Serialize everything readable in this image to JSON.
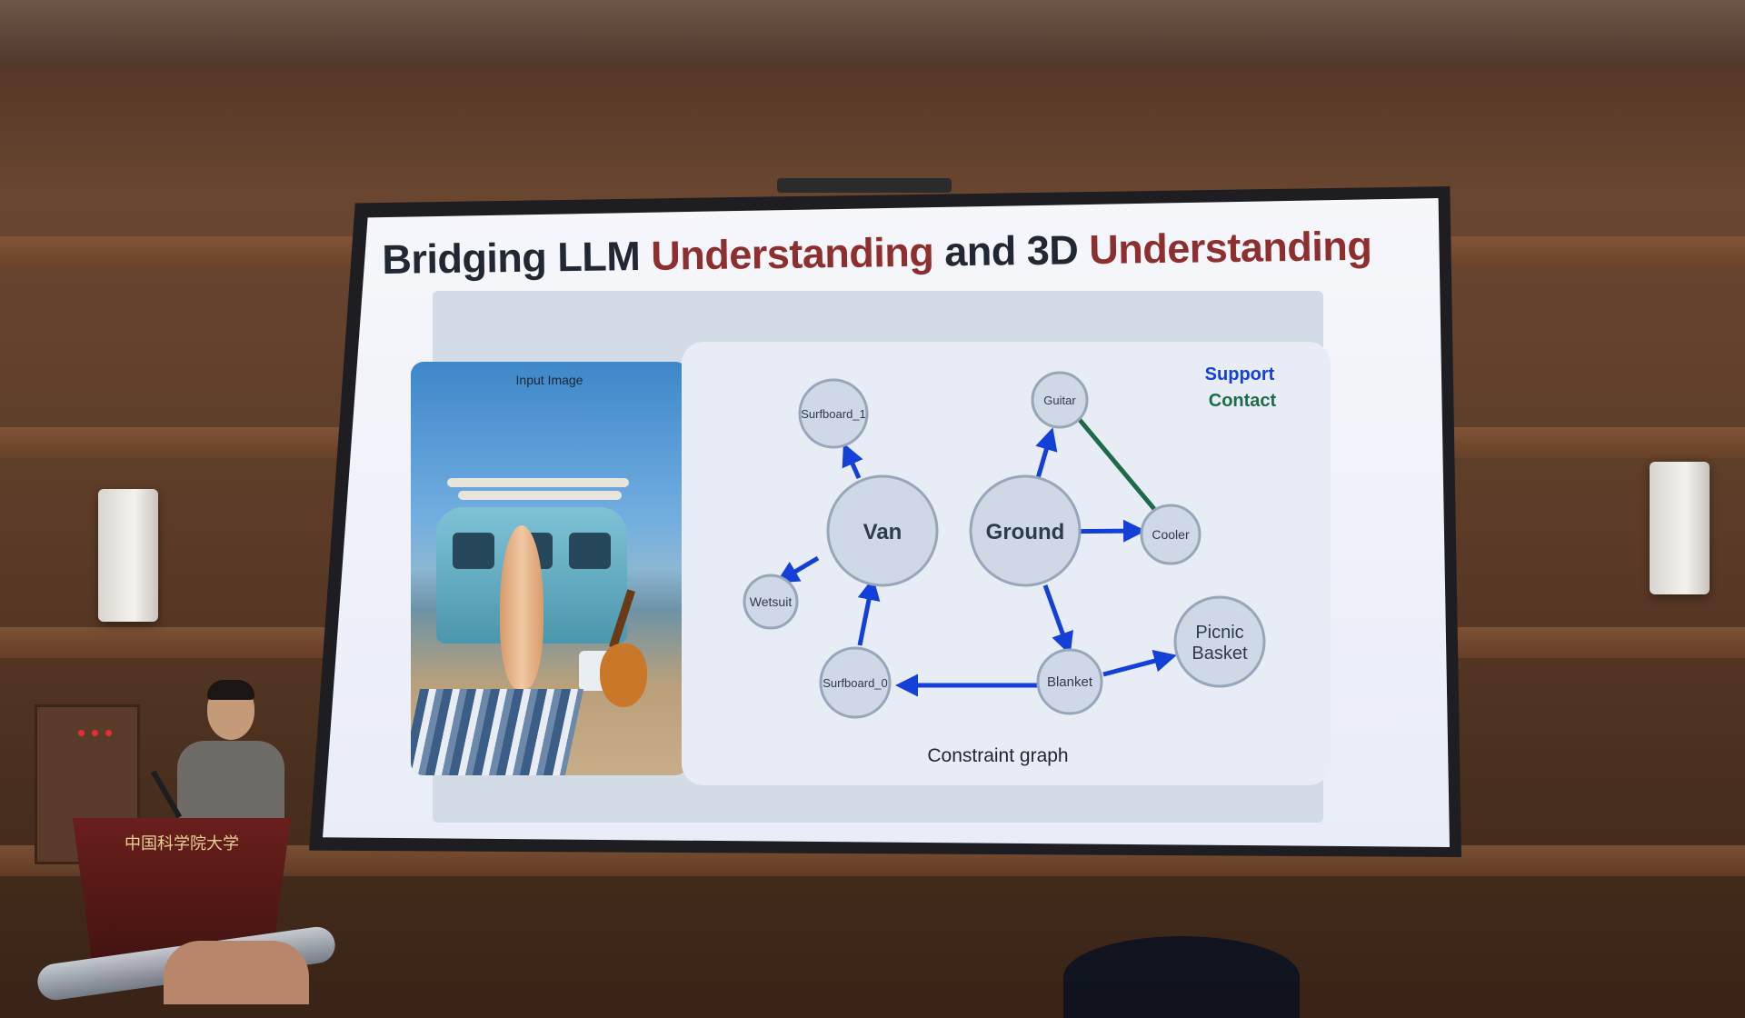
{
  "slide": {
    "title_prefix": "Bridging LLM ",
    "title_word_1": "Understanding",
    "title_middle": " and 3D ",
    "title_word_2": "Understanding",
    "input_image_label": "Input Image",
    "caption": "Constraint graph",
    "legend": {
      "support": "Support",
      "contact": "Contact"
    },
    "nodes": {
      "surfboard_1": "Surfboard_1",
      "guitar": "Guitar",
      "van": "Van",
      "ground": "Ground",
      "cooler": "Cooler",
      "wetsuit": "Wetsuit",
      "picnic_basket_line1": "Picnic",
      "picnic_basket_line2": "Basket",
      "surfboard_0": "Surfboard_0",
      "blanket": "Blanket"
    }
  },
  "colors": {
    "title_accent": "#8e2f2f",
    "support_arrow": "#1440d8",
    "contact_line": "#1e6b4a"
  },
  "room": {
    "podium_sign": "中国科学院大学"
  }
}
